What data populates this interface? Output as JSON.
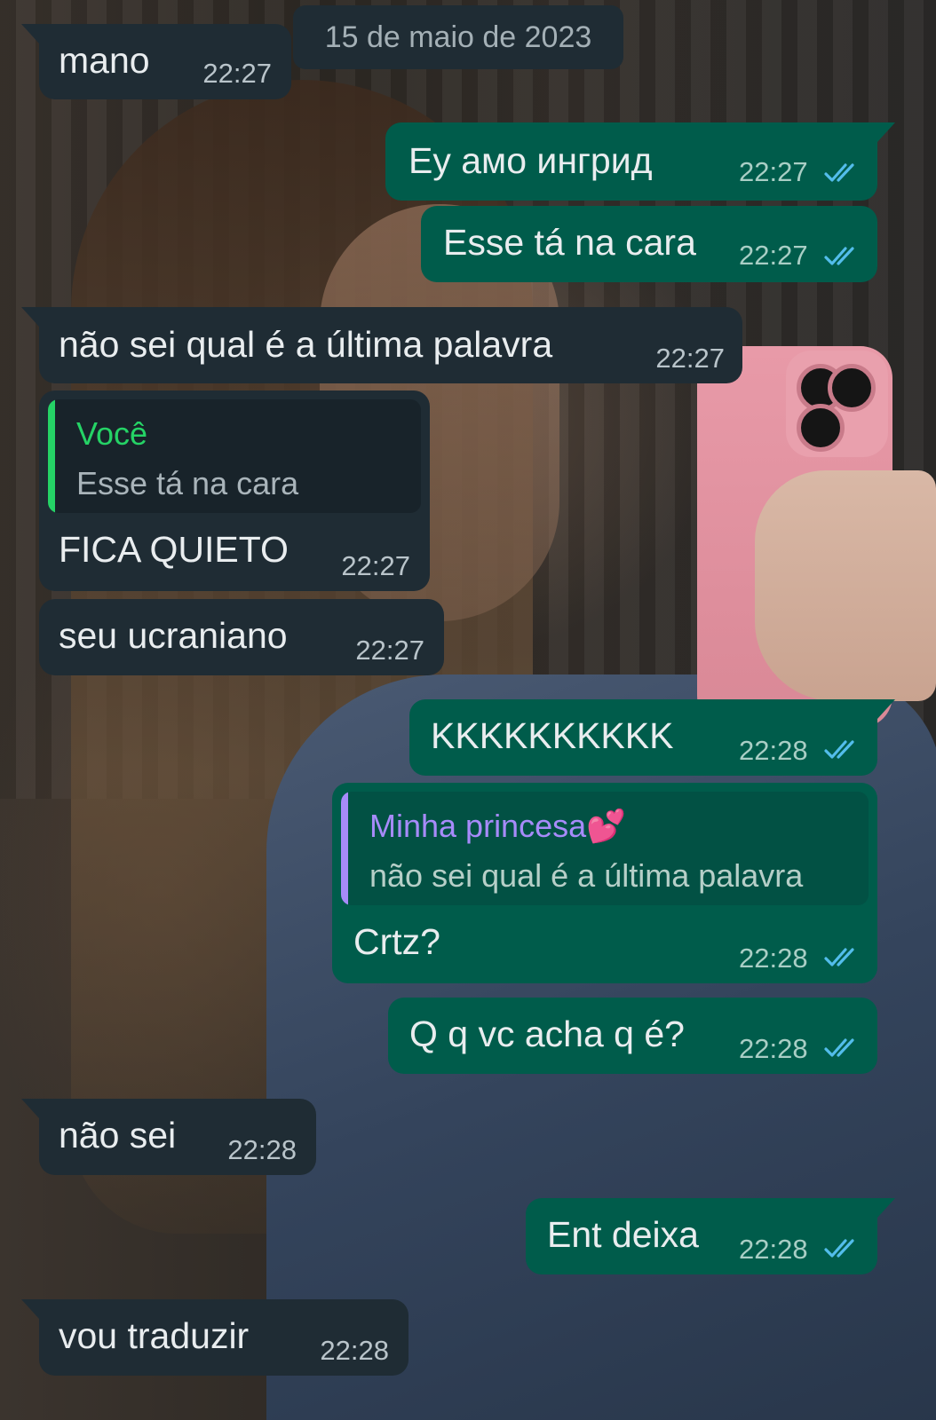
{
  "date_chip": "15 de maio de 2023",
  "messages": [
    {
      "side": "in",
      "text": "mano",
      "time": "22:27"
    },
    {
      "side": "out",
      "text": "Еу амо ингрид",
      "time": "22:27",
      "status": "read"
    },
    {
      "side": "out",
      "text": "Esse tá na cara",
      "time": "22:27",
      "status": "read"
    },
    {
      "side": "in",
      "text": "não sei qual é a última palavra",
      "time": "22:27"
    },
    {
      "side": "in",
      "text": "FICA QUIETO",
      "time": "22:27",
      "quote": {
        "author": "Você",
        "text": "Esse tá na cara"
      }
    },
    {
      "side": "in",
      "text": "seu ucraniano",
      "time": "22:27"
    },
    {
      "side": "out",
      "text": "KKKKKKKKKK",
      "time": "22:28",
      "status": "read"
    },
    {
      "side": "out",
      "text": "Crtz?",
      "time": "22:28",
      "status": "read",
      "quote": {
        "author": "Minha princesa💕",
        "text": "não sei qual é a última palavra"
      }
    },
    {
      "side": "out",
      "text": "Q q vc acha q é?",
      "time": "22:28",
      "status": "read"
    },
    {
      "side": "in",
      "text": "não sei",
      "time": "22:28"
    },
    {
      "side": "out",
      "text": "Ent deixa",
      "time": "22:28",
      "status": "read"
    },
    {
      "side": "in",
      "text": "vou traduzir",
      "time": "22:28"
    }
  ],
  "colors": {
    "incoming_bubble": "#1f2c34",
    "outgoing_bubble": "#005c4b",
    "read_ticks": "#53bdeb",
    "quote_you": "#25d366",
    "quote_contact": "#a78bfa"
  },
  "icons": {
    "read_receipt": "double-check-icon"
  }
}
